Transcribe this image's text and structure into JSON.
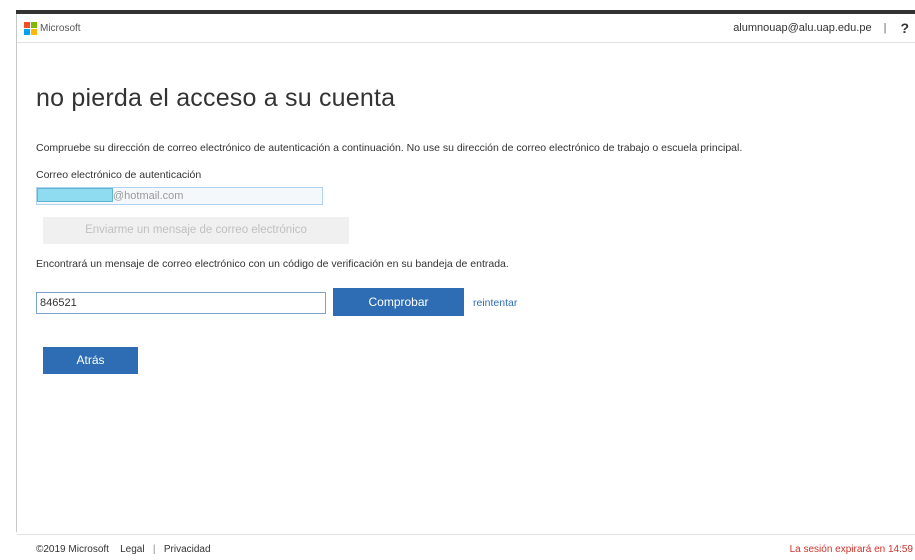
{
  "header": {
    "logo_text": "Microsoft",
    "account_email": "alumnouap@alu.uap.edu.pe",
    "separator": "|",
    "help_label": "?"
  },
  "main": {
    "title": "no pierda el acceso a su cuenta",
    "instructions": "Compruebe su dirección de correo electrónico de autenticación a continuación. No use su dirección de correo electrónico de trabajo o escuela principal.",
    "auth_email_label": "Correo electrónico de autenticación",
    "auth_email_value": "@hotmail.com",
    "send_email_button": "Enviarme un mensaje de correo electrónico",
    "info_text": "Encontrará un mensaje de correo electrónico con un código de verificación en su bandeja de entrada.",
    "code_value": "846521",
    "verify_button": "Comprobar",
    "retry_link": "reintentar",
    "back_button": "Atrás"
  },
  "footer": {
    "copyright": "©2019 Microsoft",
    "legal": "Legal",
    "separator": "|",
    "privacy": "Privacidad",
    "session_notice": "La sesión expirará en 14:59"
  },
  "colors": {
    "accent": "#2e6db4",
    "session_warning": "#d0332a",
    "logo_red": "#f25022",
    "logo_green": "#7fba00",
    "logo_blue": "#00a4ef",
    "logo_yellow": "#ffb900"
  }
}
